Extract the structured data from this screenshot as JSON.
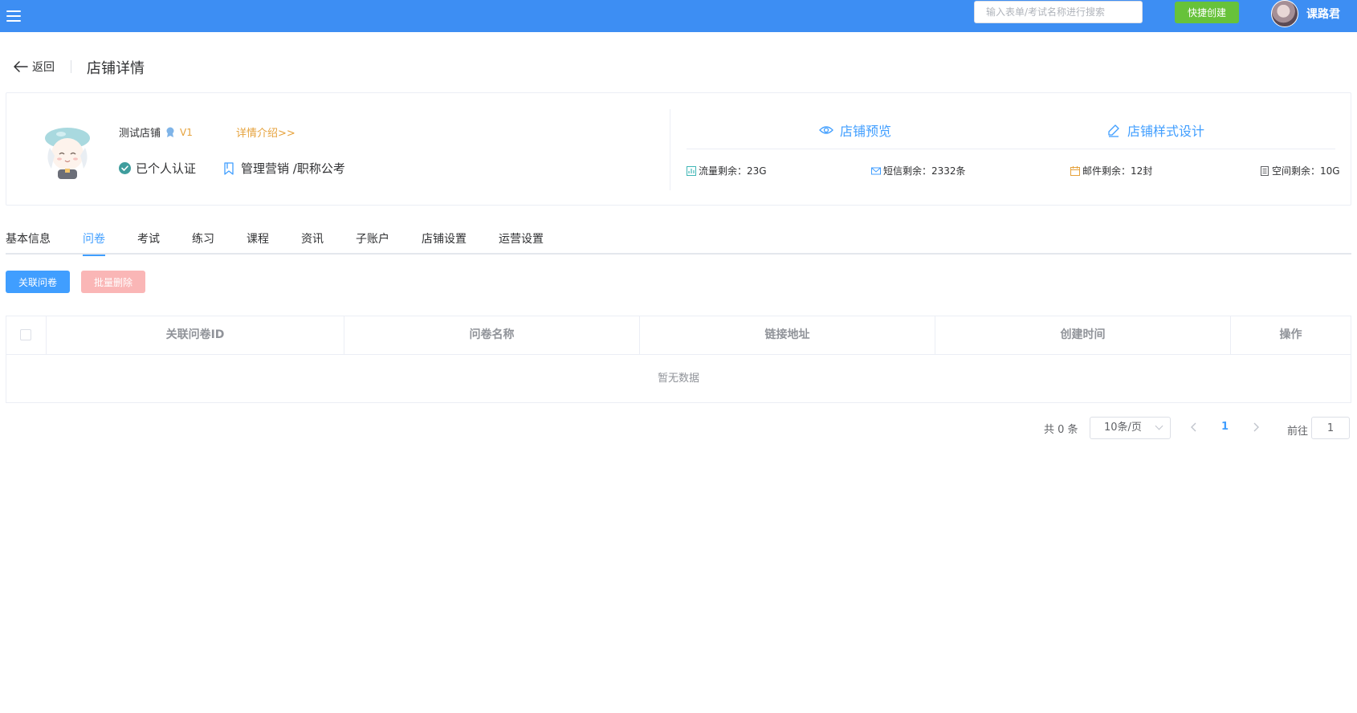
{
  "topbar": {
    "search_placeholder": "输入表单/考试名称进行搜索",
    "quick_create_label": "快捷创建",
    "username": "课路君",
    "bg_color": "#3d8ef3"
  },
  "header": {
    "back_label": "返回",
    "title": "店铺详情"
  },
  "store": {
    "name": "测试店铺",
    "level": "V1",
    "detail_link": "详情介绍>>",
    "verified_label": "已个人认证",
    "category": "管理营销 /职称公考",
    "actions": {
      "preview": "店铺预览",
      "design": "店铺样式设计"
    },
    "stats": {
      "traffic": "流量剩余：23G",
      "sms": "短信剩余：2332条",
      "mail": "邮件剩余：12封",
      "space": "空间剩余：10G"
    }
  },
  "tabs": [
    {
      "label": "基本信息"
    },
    {
      "label": "问卷"
    },
    {
      "label": "考试"
    },
    {
      "label": "练习"
    },
    {
      "label": "课程"
    },
    {
      "label": "资讯"
    },
    {
      "label": "子账户"
    },
    {
      "label": "店铺设置"
    },
    {
      "label": "运营设置"
    }
  ],
  "active_tab": "问卷",
  "toolbar": {
    "link_label": "关联问卷",
    "delete_label": "批量删除"
  },
  "table": {
    "columns": [
      "关联问卷ID",
      "问卷名称",
      "链接地址",
      "创建时间",
      "操作"
    ],
    "empty_text": "暂无数据"
  },
  "pagination": {
    "total": "共 0 条",
    "page_size": "10条/页",
    "current_page": "1",
    "goto_label": "前往",
    "goto_value": "1"
  },
  "colors": {
    "primary": "#409eff",
    "success": "#67c23a",
    "warning": "#e6a23c",
    "danger_light": "#fab6b6"
  }
}
